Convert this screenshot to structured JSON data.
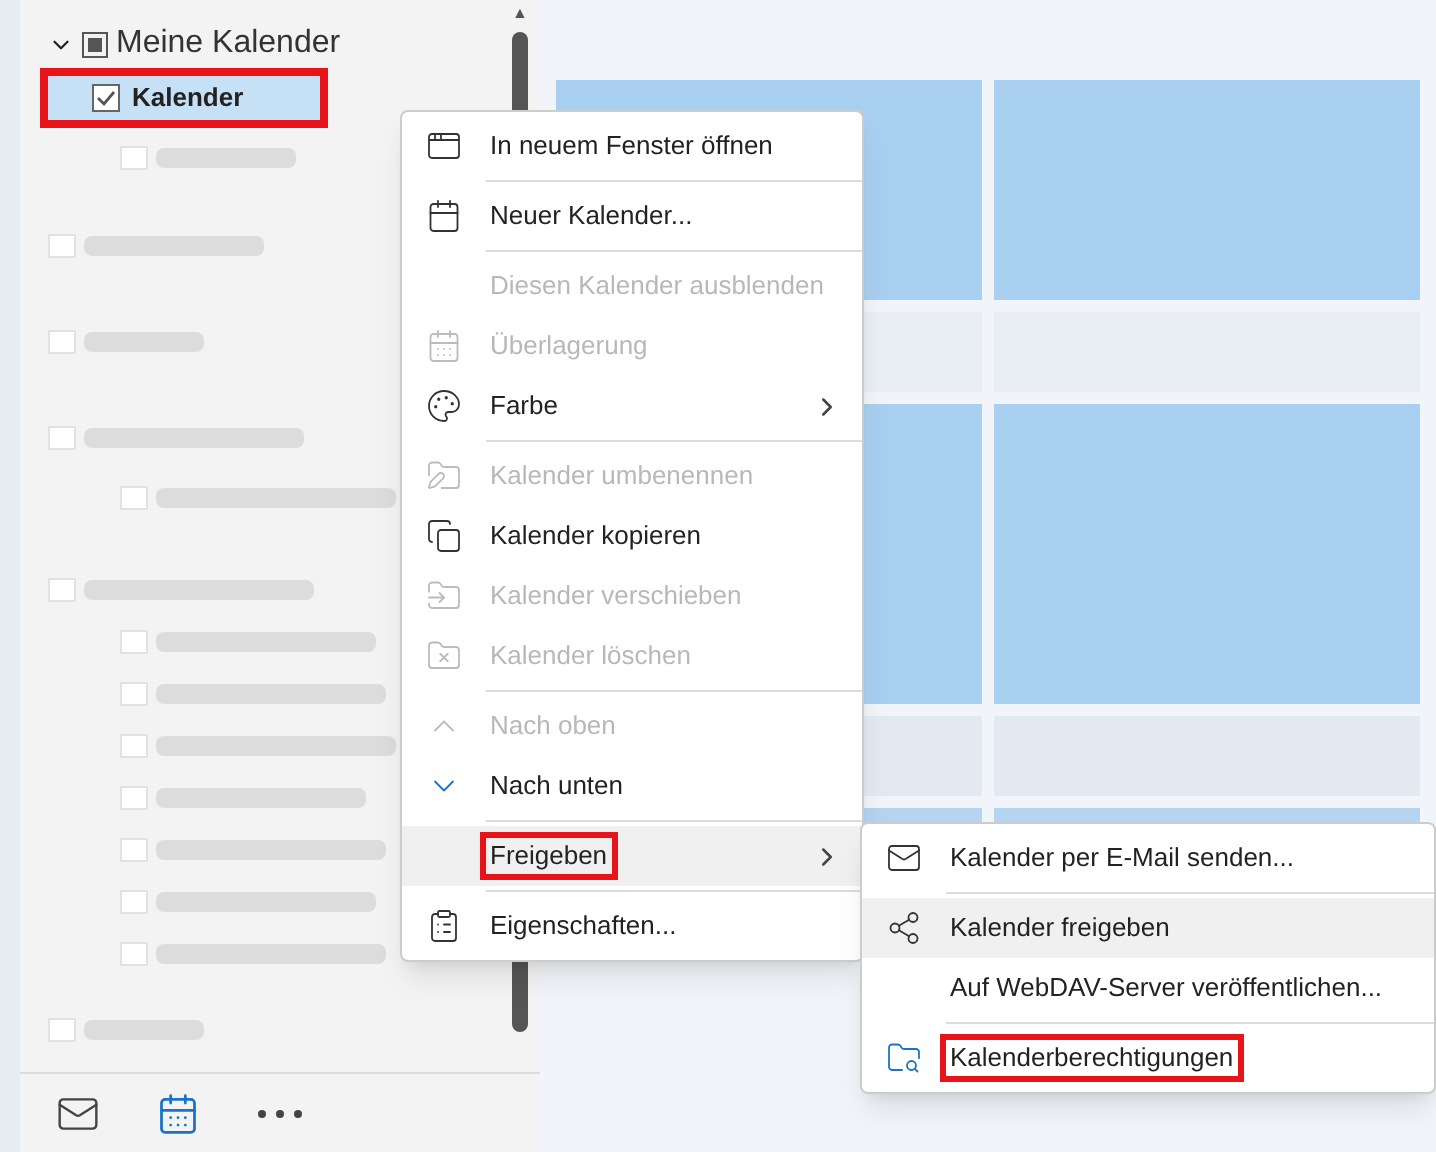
{
  "folder_tree": {
    "group": {
      "label": "Meine Kalender",
      "expanded": true,
      "partial": true
    },
    "items": [
      {
        "label": "Kalender",
        "checked": true,
        "selected": true,
        "highlighted": true
      }
    ]
  },
  "scroll_up": {
    "label": "▲"
  },
  "context_menu": {
    "items": [
      {
        "label": "In neuem Fenster öffnen",
        "disabled": false,
        "submenu": false,
        "highlighted": false,
        "separator_after": true
      },
      {
        "label": "Neuer Kalender...",
        "disabled": false,
        "submenu": false,
        "highlighted": false,
        "separator_after": true
      },
      {
        "label": "Diesen Kalender ausblenden",
        "disabled": true,
        "submenu": false,
        "highlighted": false,
        "separator_after": false
      },
      {
        "label": "Überlagerung",
        "disabled": true,
        "submenu": false,
        "highlighted": false,
        "separator_after": false
      },
      {
        "label": "Farbe",
        "disabled": false,
        "submenu": true,
        "highlighted": false,
        "separator_after": true
      },
      {
        "label": "Kalender umbenennen",
        "disabled": true,
        "submenu": false,
        "highlighted": false,
        "separator_after": false
      },
      {
        "label": "Kalender kopieren",
        "disabled": false,
        "submenu": false,
        "highlighted": false,
        "separator_after": false
      },
      {
        "label": "Kalender verschieben",
        "disabled": true,
        "submenu": false,
        "highlighted": false,
        "separator_after": false
      },
      {
        "label": "Kalender löschen",
        "disabled": true,
        "submenu": false,
        "highlighted": false,
        "separator_after": true
      },
      {
        "label": "Nach oben",
        "disabled": true,
        "submenu": false,
        "highlighted": false,
        "separator_after": false
      },
      {
        "label": "Nach unten",
        "disabled": false,
        "submenu": false,
        "highlighted": false,
        "separator_after": true
      },
      {
        "label": "Freigeben",
        "disabled": false,
        "submenu": true,
        "highlighted": true,
        "selected": true,
        "separator_after": true
      },
      {
        "label": "Eigenschaften...",
        "disabled": false,
        "submenu": false,
        "highlighted": false,
        "separator_after": false
      }
    ]
  },
  "submenu": {
    "items": [
      {
        "label": "Kalender per E-Mail senden...",
        "selected": false,
        "highlighted": false,
        "separator_after": true
      },
      {
        "label": "Kalender freigeben",
        "selected": true,
        "highlighted": false,
        "separator_after": false
      },
      {
        "label": "Auf WebDAV-Server veröffentlichen...",
        "selected": false,
        "highlighted": false,
        "separator_after": true
      },
      {
        "label": "Kalenderberechtigungen",
        "selected": false,
        "highlighted": true,
        "separator_after": false
      }
    ]
  }
}
